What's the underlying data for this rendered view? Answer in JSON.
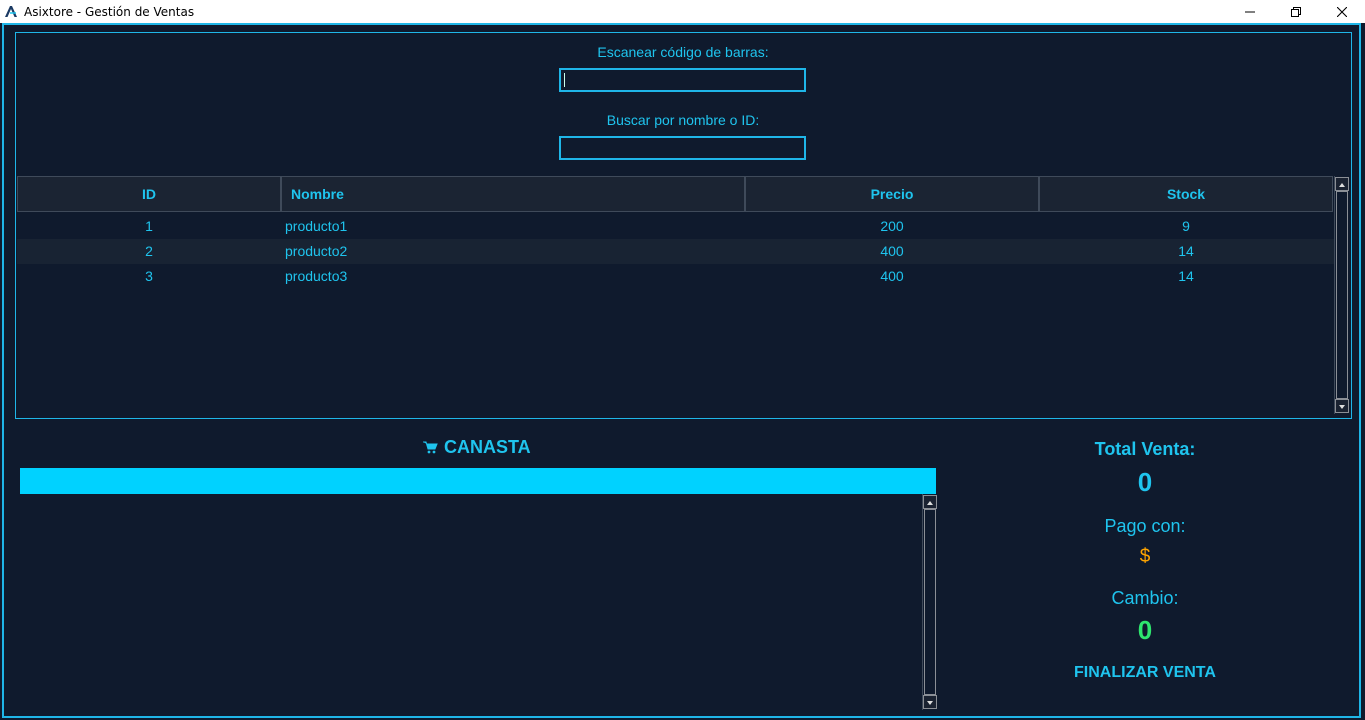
{
  "window": {
    "title": "Asixtore - Gestión de Ventas"
  },
  "search": {
    "barcode_label": "Escanear código de barras:",
    "barcode_value": "",
    "name_label": "Buscar por nombre o ID:",
    "name_value": ""
  },
  "table": {
    "headers": [
      "ID",
      "Nombre",
      "Precio",
      "Stock"
    ],
    "rows": [
      [
        "1",
        "producto1",
        "200",
        "9"
      ],
      [
        "2",
        "producto2",
        "400",
        "14"
      ],
      [
        "3",
        "producto3",
        "400",
        "14"
      ]
    ]
  },
  "cart": {
    "title": "CANASTA",
    "icon": "cart-icon"
  },
  "summary": {
    "total_label": "Total Venta:",
    "total_value": "0",
    "paid_label": "Pago con:",
    "paid_value": "$",
    "change_label": "Cambio:",
    "change_value": "0",
    "finalize_label": "FINALIZAR VENTA"
  },
  "colors": {
    "background": "#0f1a2d",
    "accent": "#1fc4ee",
    "cart_bar": "#00d2ff",
    "paid": "#ffa500",
    "change": "#2ee66e"
  }
}
